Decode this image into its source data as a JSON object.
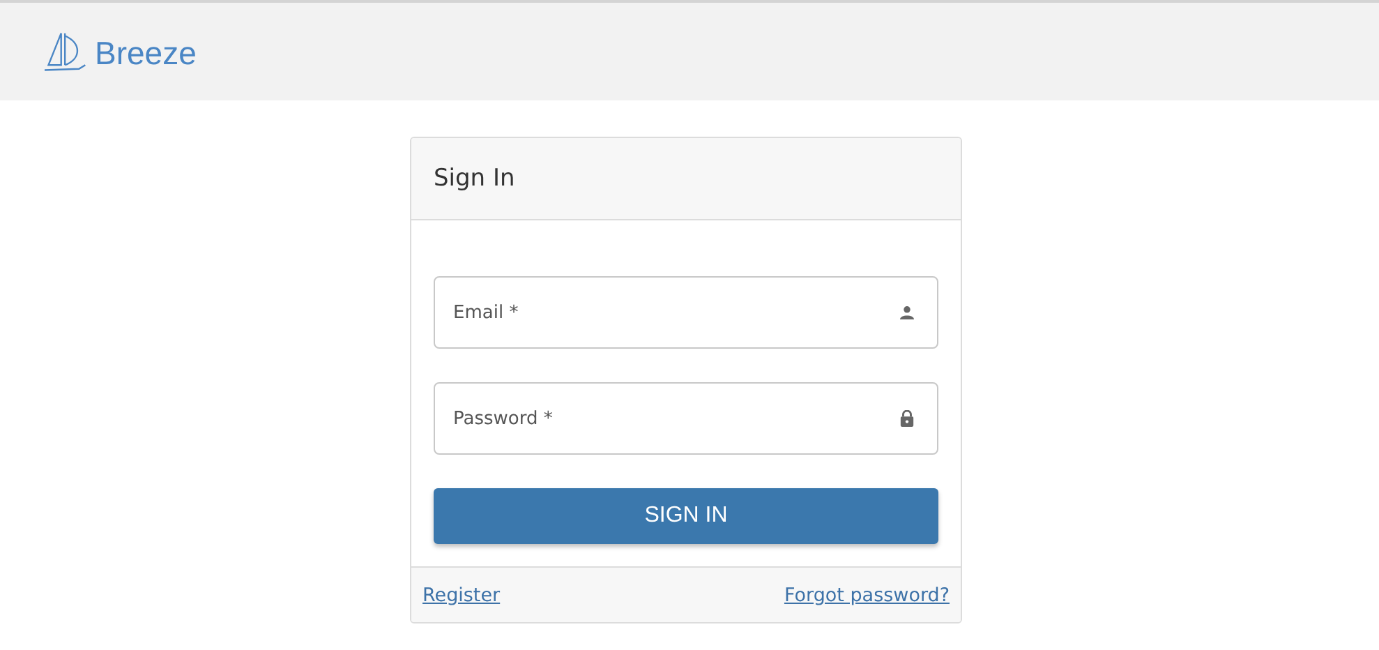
{
  "header": {
    "brand": "Breeze"
  },
  "card": {
    "title": "Sign In",
    "fields": [
      {
        "kind": "email",
        "placeholder": "Email *"
      },
      {
        "kind": "password",
        "placeholder": "Password *"
      }
    ],
    "submit": "SIGN IN",
    "links": [
      {
        "label": "Register"
      },
      {
        "label": "Forgot password?"
      }
    ]
  }
}
